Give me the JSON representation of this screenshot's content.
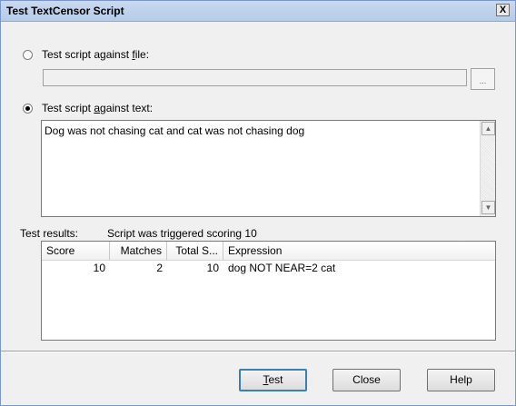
{
  "window": {
    "title": "Test TextCensor Script",
    "close_label": "X"
  },
  "file_option": {
    "label_prefix": "Test script against ",
    "accel": "f",
    "label_suffix": "ile:",
    "browse_label": "...",
    "file_value": ""
  },
  "text_option": {
    "label_prefix": "Test script ",
    "accel": "a",
    "label_suffix": "gainst text:",
    "text_value": "Dog was not chasing cat and cat was not chasing dog"
  },
  "results": {
    "label": "Test results:",
    "status": "Script was triggered scoring 10",
    "columns": [
      "Score",
      "Matches",
      "Total S...",
      "Expression"
    ],
    "rows": [
      {
        "score": "10",
        "matches": "2",
        "total": "10",
        "expression": "dog NOT NEAR=2 cat"
      }
    ]
  },
  "buttons": {
    "test_accel": "T",
    "test_rest": "est",
    "close": "Close",
    "help": "Help"
  },
  "icons": {
    "scroll_up": "scroll-up-arrow-icon",
    "scroll_down": "scroll-down-arrow-icon"
  },
  "colors": {
    "title_gradient": "#c9d9f0",
    "default_button_border": "#3c7fb1"
  }
}
